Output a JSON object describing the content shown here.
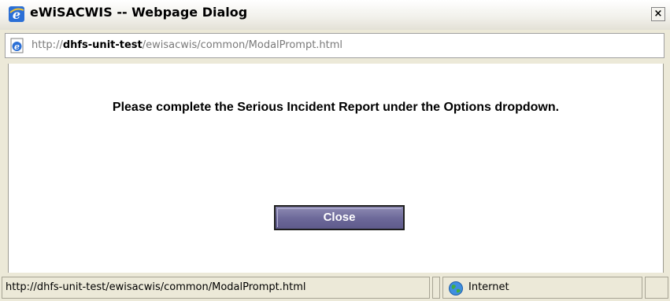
{
  "window": {
    "title": "eWiSACWIS -- Webpage Dialog",
    "close_glyph": "×"
  },
  "address": {
    "protocol": "http://",
    "host": "dhfs-unit-test",
    "path": "/ewisacwis/common/ModalPrompt.html"
  },
  "dialog": {
    "message": "Please complete the Serious Incident Report under the Options dropdown.",
    "close_label": "Close"
  },
  "status": {
    "url": "http://dhfs-unit-test/ewisacwis/common/ModalPrompt.html",
    "zone": "Internet"
  },
  "icons": {
    "title": "ie-icon",
    "address": "ie-page-icon",
    "zone": "globe-icon"
  },
  "colors": {
    "button_bg": "#6c6899",
    "button_text": "#ffffff",
    "window_chrome": "#ece9d8"
  }
}
